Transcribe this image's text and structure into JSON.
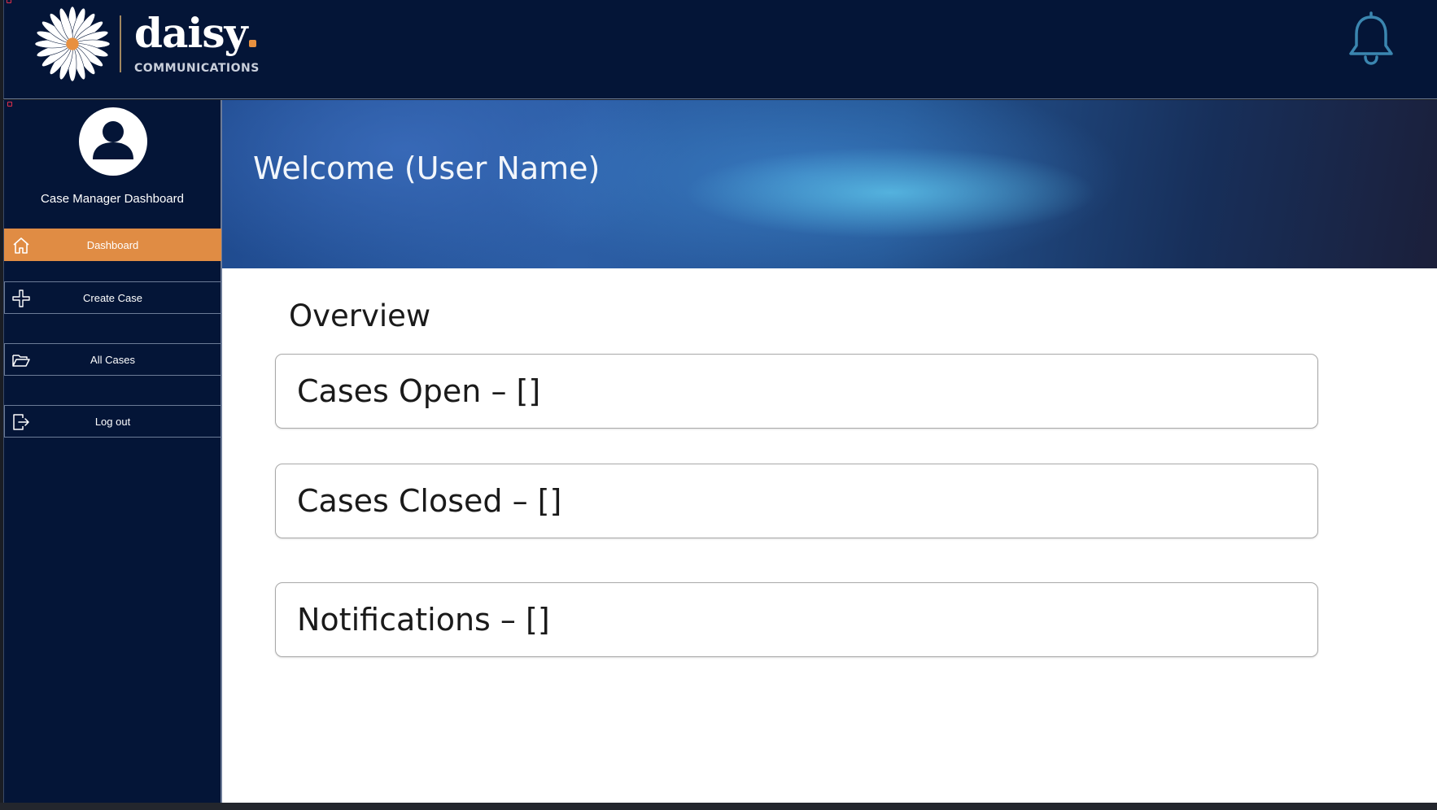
{
  "header": {
    "brand_name": "daisy",
    "brand_sub": "COMMUNICATIONS",
    "icons": {
      "logo": "daisy-flower-logo",
      "notifications": "bell-icon"
    },
    "colors": {
      "navy": "#041537",
      "accent": "#e08c44",
      "bell": "#3b86b0"
    }
  },
  "sidebar": {
    "role_label": "Case Manager Dashboard",
    "avatar_icon": "user-avatar-icon",
    "items": [
      {
        "label": "Dashboard",
        "icon": "home-icon",
        "active": true
      },
      {
        "label": "Create Case",
        "icon": "plus-icon",
        "active": false
      },
      {
        "label": "All Cases",
        "icon": "folder-open-icon",
        "active": false
      },
      {
        "label": "Log out",
        "icon": "logout-icon",
        "active": false
      }
    ]
  },
  "main": {
    "welcome_text": "Welcome (User Name)",
    "overview_title": "Overview",
    "cards": [
      {
        "label": "Cases Open – []"
      },
      {
        "label": "Cases Closed – []"
      },
      {
        "label": "Notifications – []"
      }
    ]
  }
}
